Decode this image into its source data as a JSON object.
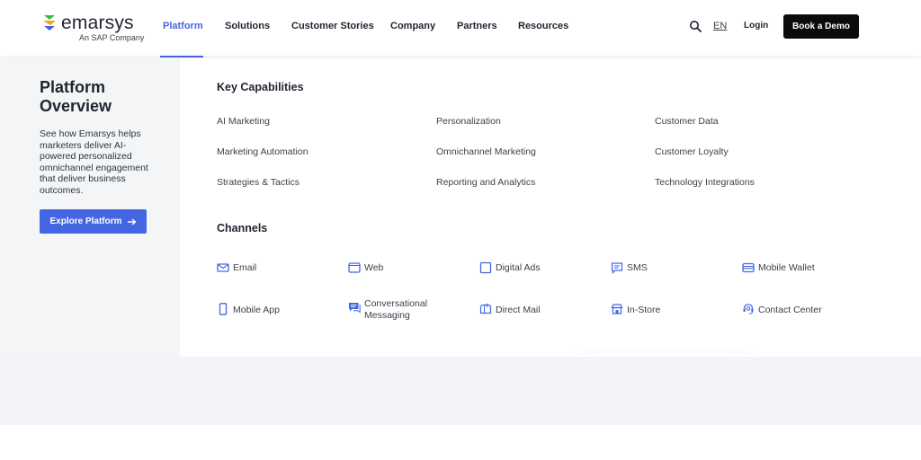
{
  "header": {
    "logo": {
      "word": "emarsys",
      "sub": "An SAP Company"
    },
    "nav": [
      {
        "label": "Platform",
        "active": true
      },
      {
        "label": "Solutions"
      },
      {
        "label": "Customer Stories"
      },
      {
        "label": "Company"
      },
      {
        "label": "Partners"
      },
      {
        "label": "Resources"
      }
    ],
    "search_icon": "search-icon",
    "language": "EN",
    "login": "Login",
    "demo_button": "Book a Demo"
  },
  "menu": {
    "overview": {
      "title": "Platform Overview",
      "description": "See how Emarsys helps marketers deliver AI-powered personalized omnichannel engagement that deliver business outcomes.",
      "button_label": "Explore Platform",
      "button_icon": "arrow-right-icon"
    },
    "key_capabilities": {
      "title": "Key Capabilities",
      "items": [
        "AI Marketing",
        "Personalization",
        "Customer Data",
        "Marketing Automation",
        "Omnichannel Marketing",
        "Customer Loyalty",
        "Strategies & Tactics",
        "Reporting and Analytics",
        "Technology Integrations"
      ]
    },
    "channels": {
      "title": "Channels",
      "items": [
        {
          "label": "Email",
          "icon": "email-icon"
        },
        {
          "label": "Web",
          "icon": "web-icon"
        },
        {
          "label": "Digital Ads",
          "icon": "digital-ads-icon"
        },
        {
          "label": "SMS",
          "icon": "sms-icon"
        },
        {
          "label": "Mobile Wallet",
          "icon": "mobile-wallet-icon"
        },
        {
          "label": "Mobile App",
          "icon": "mobile-app-icon"
        },
        {
          "label": "Conversational Messaging",
          "icon": "conversational-messaging-icon"
        },
        {
          "label": "Direct Mail",
          "icon": "direct-mail-icon"
        },
        {
          "label": "In-Store",
          "icon": "in-store-icon"
        },
        {
          "label": "Contact Center",
          "icon": "contact-center-icon"
        }
      ]
    }
  },
  "colors": {
    "accent": "#4466e2",
    "dark_button": "#0b0b0b",
    "sidebar_bg": "#f4f5f7"
  }
}
